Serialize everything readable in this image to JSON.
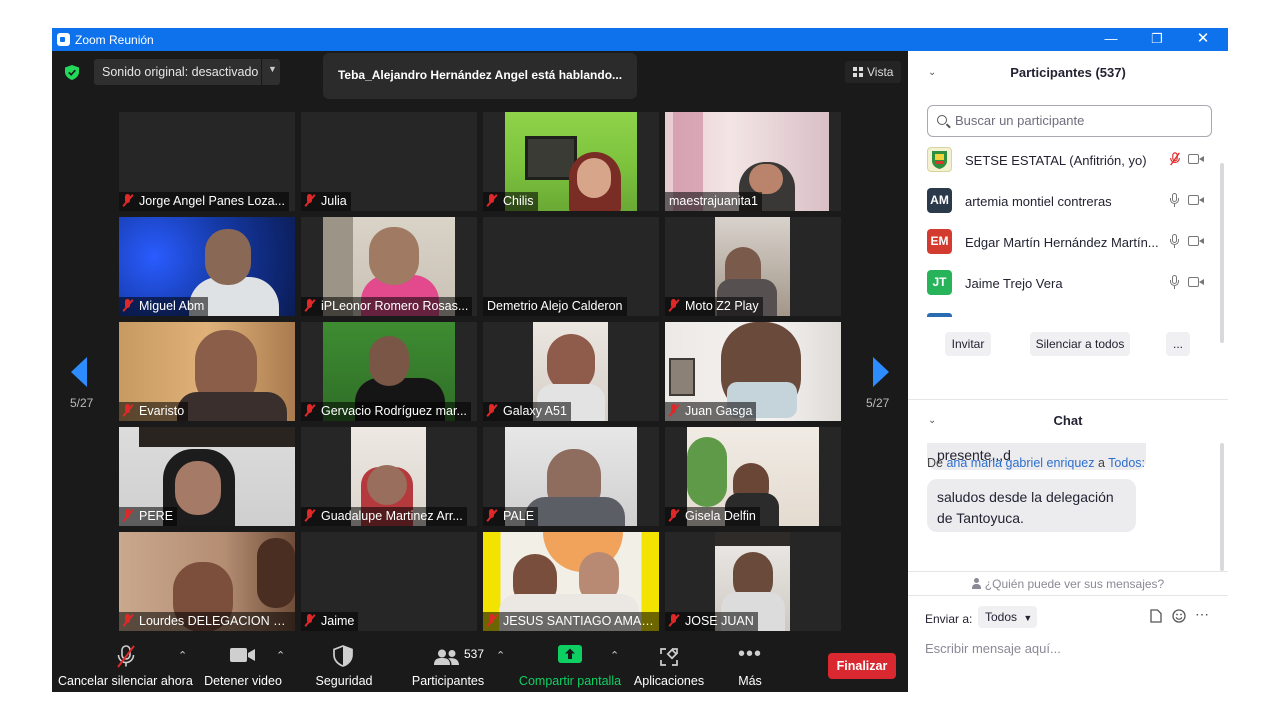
{
  "window": {
    "title": "Zoom Reunión"
  },
  "colors": {
    "titlebar": "#0e72ed",
    "accent": "#2d8cff",
    "end": "#d9282f",
    "share": "#0ed062",
    "muted": "#e02828"
  },
  "meeting": {
    "audio_label": "Sonido original: desactivado",
    "speaking_banner": "Teba_Alejandro Hernández Angel está hablando...",
    "view_label": "Vista",
    "page_indicator": "5/27",
    "tiles": [
      {
        "name": "Jorge Angel Panes Loza...",
        "muted": true
      },
      {
        "name": "Julia",
        "muted": true
      },
      {
        "name": "Chilis",
        "muted": true
      },
      {
        "name": "maestrajuanita1",
        "muted": false
      },
      {
        "name": "Miguel Abm",
        "muted": true
      },
      {
        "name": "iPLeonor Romero Rosas...",
        "muted": true
      },
      {
        "name": "Demetrio Alejo Calderon",
        "muted": false
      },
      {
        "name": "Moto Z2 Play",
        "muted": true
      },
      {
        "name": "Evaristo",
        "muted": true
      },
      {
        "name": "Gervacio Rodríguez mar...",
        "muted": true
      },
      {
        "name": "Galaxy A51",
        "muted": true
      },
      {
        "name": "Juan Gasga",
        "muted": true
      },
      {
        "name": "PERE",
        "muted": true
      },
      {
        "name": "Guadalupe Martinez Arr...",
        "muted": true
      },
      {
        "name": "PALE",
        "muted": true
      },
      {
        "name": "Gisela Delfin",
        "muted": true
      },
      {
        "name": "Lourdes DELEGACION XIX",
        "muted": true
      },
      {
        "name": "Jaime",
        "muted": true
      },
      {
        "name": "JESUS SANTIAGO AMAD...",
        "muted": true
      },
      {
        "name": "JOSE JUAN",
        "muted": true
      }
    ]
  },
  "toolbar": {
    "unmute": "Cancelar silenciar ahora",
    "stop_video": "Detener video",
    "security": "Seguridad",
    "participants": "Participantes",
    "participants_count": "537",
    "share": "Compartir pantalla",
    "apps": "Aplicaciones",
    "more": "Más",
    "end": "Finalizar"
  },
  "participants_panel": {
    "title": "Participantes (537)",
    "search_placeholder": "Buscar un participante",
    "list": [
      {
        "initials": "",
        "name": "SETSE ESTATAL (Anfitrión, yo)",
        "avatar_color": "#f3f1d2"
      },
      {
        "initials": "AM",
        "name": "artemia montiel contreras",
        "avatar_color": "#2b3a4a"
      },
      {
        "initials": "EM",
        "name": "Edgar Martín Hernández Martín...",
        "avatar_color": "#d23b2e"
      },
      {
        "initials": "JT",
        "name": "Jaime Trejo Vera",
        "avatar_color": "#27b35a"
      }
    ],
    "invite": "Invitar",
    "mute_all": "Silenciar a todos",
    "more": "..."
  },
  "chat": {
    "title": "Chat",
    "msg1": "presente,,,d",
    "from_prefix": "De",
    "from_name": "ana maria gabriel enriquez",
    "from_to": "a",
    "to_name": "Todos:",
    "msg2_line1": "saludos desde la delegación",
    "msg2_line2": "de Tantoyuca.",
    "privacy": "¿Quién puede ver sus mensajes?",
    "send_to_label": "Enviar a:",
    "send_to_value": "Todos",
    "compose_placeholder": "Escribir mensaje aquí..."
  }
}
